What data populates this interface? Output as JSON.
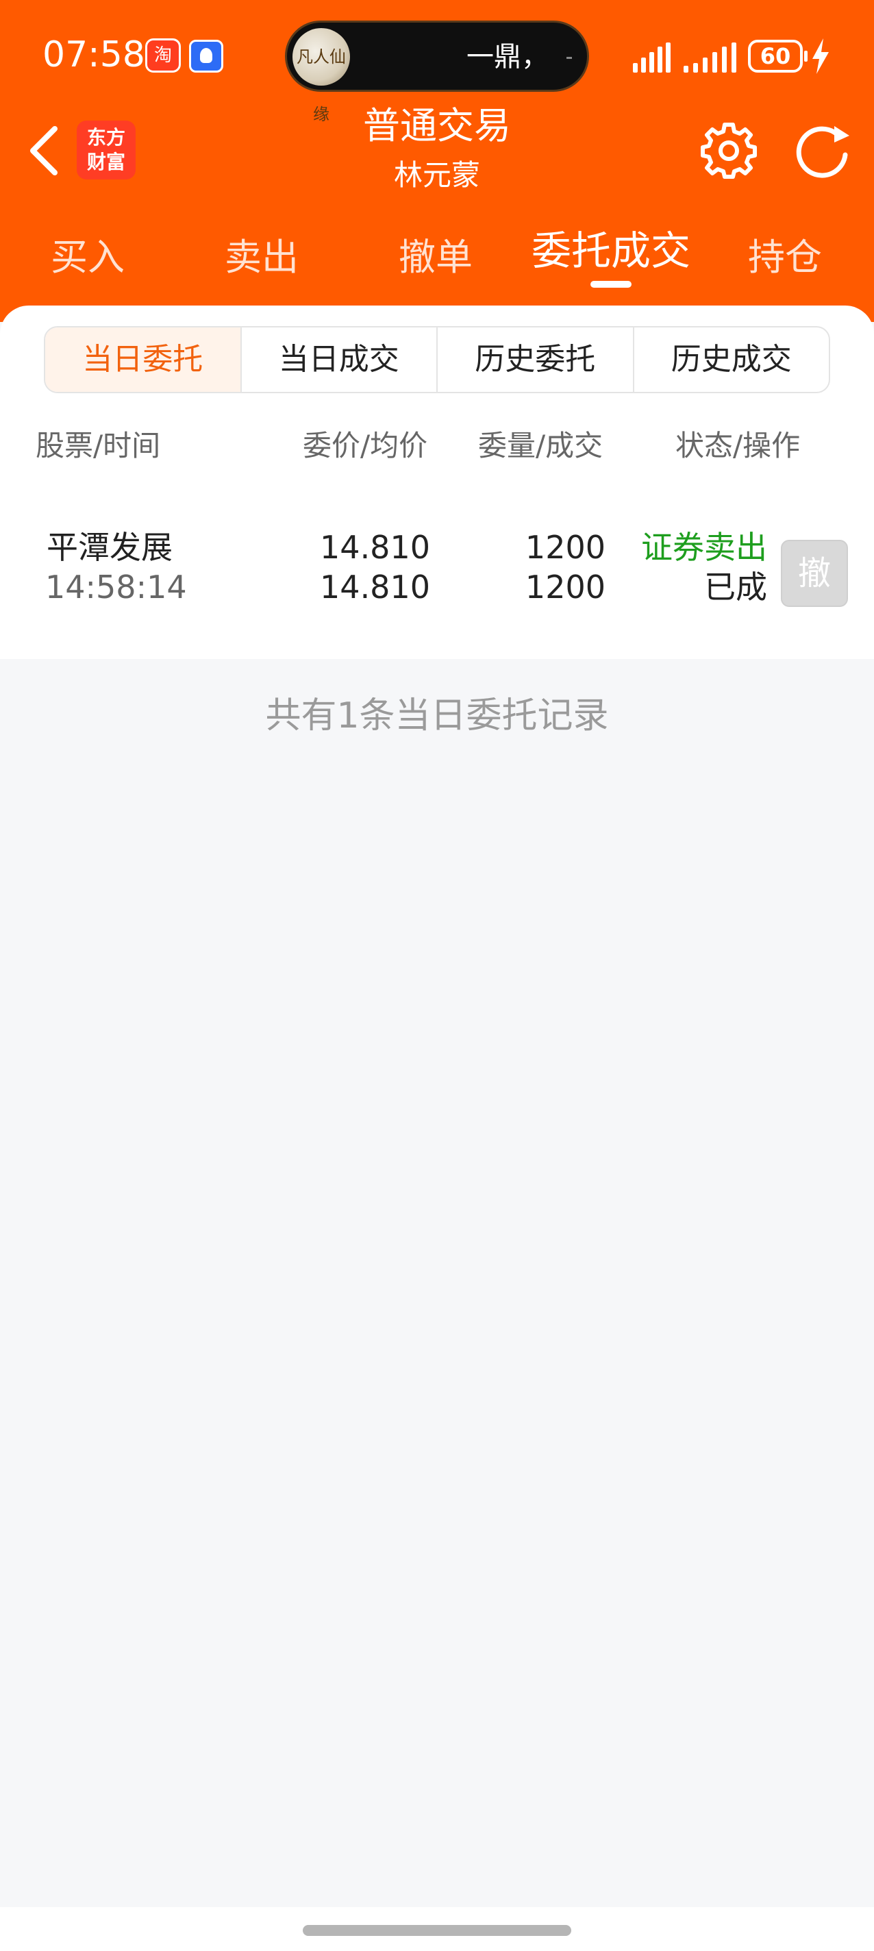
{
  "status_bar": {
    "time": "07:58",
    "app_badge": "淘",
    "island_text": "一鼎，",
    "island_avatar_text": "凡人仙缘",
    "battery": "60"
  },
  "nav": {
    "title": "普通交易",
    "subtitle": "林元蒙",
    "brand_line1": "东方",
    "brand_line2": "财富"
  },
  "main_tabs": [
    {
      "label": "买入"
    },
    {
      "label": "卖出"
    },
    {
      "label": "撤单"
    },
    {
      "label": "委托成交"
    },
    {
      "label": "持仓"
    }
  ],
  "active_main_tab": "委托成交",
  "sub_tabs": [
    {
      "label": "当日委托"
    },
    {
      "label": "当日成交"
    },
    {
      "label": "历史委托"
    },
    {
      "label": "历史成交"
    }
  ],
  "columns": [
    "股票/时间",
    "委价/均价",
    "委量/成交",
    "状态/操作"
  ],
  "orders": [
    {
      "stock": "平潭发展",
      "time": "14:58:14",
      "order_price": "14.810",
      "avg_price": "14.810",
      "order_qty": "1200",
      "filled_qty": "1200",
      "type": "证券卖出",
      "status": "已成",
      "action": "撤"
    }
  ],
  "footer_note": "共有1条当日委托记录",
  "colors": {
    "header": "#ff5a00",
    "accent": "#f2620e",
    "sell_green": "#1e9e1e",
    "background": "#f6f7f9"
  }
}
